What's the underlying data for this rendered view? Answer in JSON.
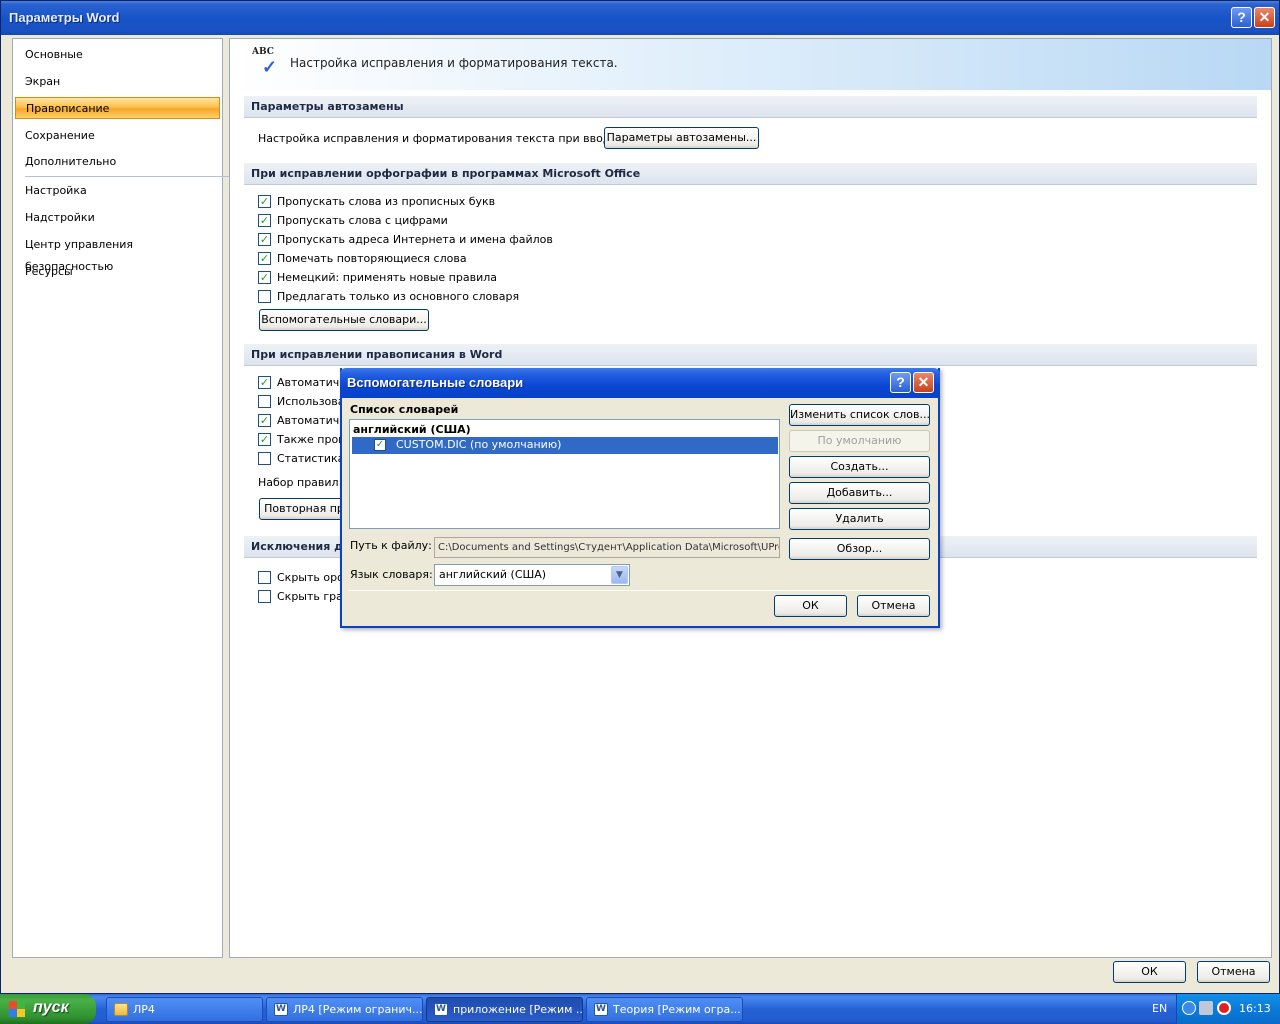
{
  "window": {
    "title": "Параметры Word",
    "help_label": "?",
    "close_label": "✕"
  },
  "sidebar": {
    "items": [
      {
        "label": "Основные"
      },
      {
        "label": "Экран"
      },
      {
        "label": "Правописание"
      },
      {
        "label": "Сохранение"
      },
      {
        "label": "Дополнительно"
      },
      {
        "label": "Настройка"
      },
      {
        "label": "Надстройки"
      },
      {
        "label": "Центр управления безопасностью"
      },
      {
        "label": "Ресурсы"
      }
    ]
  },
  "main": {
    "banner_text": "Настройка исправления и форматирования текста.",
    "banner_icon_text": "ABC",
    "autocorrect": {
      "heading": "Параметры автозамены",
      "label": "Настройка исправления и форматирования текста при вводе:",
      "button": "Параметры автозамены..."
    },
    "office_spelling": {
      "heading": "При исправлении орфографии в программах Microsoft Office",
      "options": [
        {
          "label": "Пропускать слова из прописных букв",
          "checked": true
        },
        {
          "label": "Пропускать слова с цифрами",
          "checked": true
        },
        {
          "label": "Пропускать адреса Интернета и имена файлов",
          "checked": true
        },
        {
          "label": "Помечать повторяющиеся слова",
          "checked": true
        },
        {
          "label": "Немецкий: применять новые правила",
          "checked": true
        },
        {
          "label": "Предлагать только из основного словаря",
          "checked": false
        }
      ],
      "button": "Вспомогательные словари..."
    },
    "word_spelling": {
      "heading": "При исправлении правописания в Word",
      "options": [
        {
          "label": "Автоматиче",
          "checked": true
        },
        {
          "label": "Использова",
          "checked": false
        },
        {
          "label": "Автоматиче",
          "checked": true
        },
        {
          "label": "Также прове",
          "checked": true
        },
        {
          "label": "Статистика у",
          "checked": false
        }
      ],
      "rules_label": "Набор правил:",
      "recheck_button": "Повторная пр"
    },
    "exceptions": {
      "heading": "Исключения для",
      "options": [
        {
          "label": "Скрыть орф",
          "checked": false
        },
        {
          "label": "Скрыть грам",
          "checked": false
        }
      ]
    },
    "ok_label": "ОК",
    "cancel_label": "Отмена"
  },
  "dialog": {
    "title": "Вспомогательные словари",
    "list_label": "Список словарей",
    "group": "английский (США)",
    "selected_item": "CUSTOM.DIC (по умолчанию)",
    "buttons": {
      "edit": "Изменить список слов...",
      "default": "По умолчанию",
      "create": "Создать...",
      "add": "Добавить...",
      "remove": "Удалить",
      "browse": "Обзор..."
    },
    "path_label": "Путь к файлу:",
    "path_value": "C:\\Documents and Settings\\Студент\\Application Data\\Microsoft\\UProof",
    "lang_label": "Язык словаря:",
    "lang_value": "английский (США)",
    "ok": "ОК",
    "cancel": "Отмена"
  },
  "taskbar": {
    "start": "пуск",
    "tasks": [
      {
        "label": "ЛР4",
        "icon": "folder-icon"
      },
      {
        "label": "ЛР4 [Режим огранич...",
        "icon": "word-icon"
      },
      {
        "label": "приложение [Режим ...",
        "icon": "word-icon"
      },
      {
        "label": "Теория [Режим огра...",
        "icon": "word-icon"
      }
    ],
    "lang": "EN",
    "time": "16:13"
  }
}
